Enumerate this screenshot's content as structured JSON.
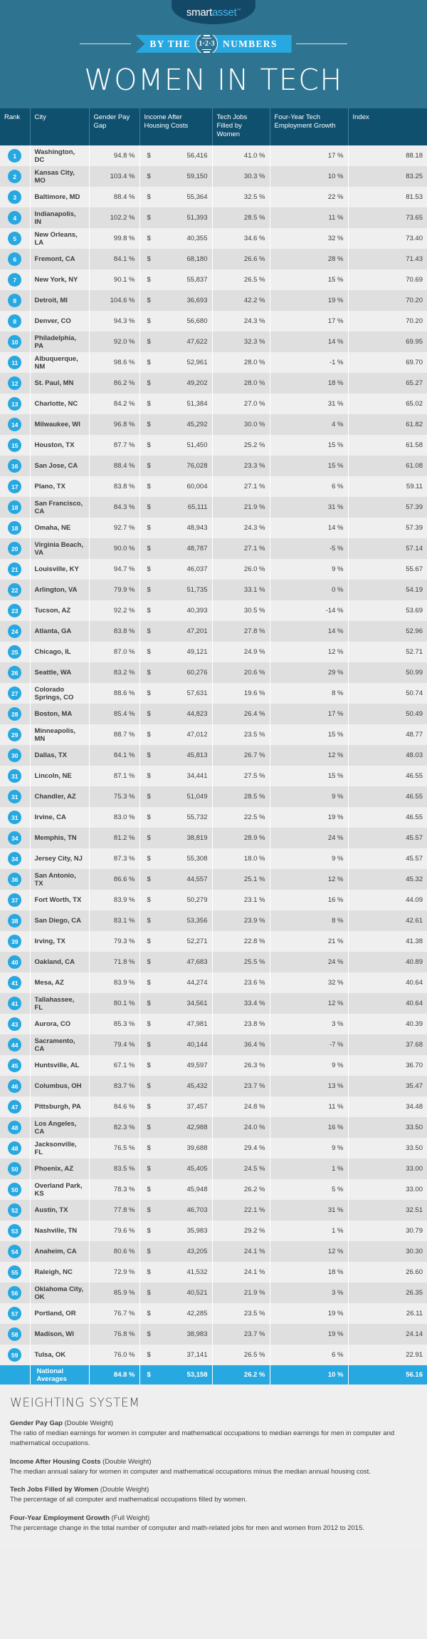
{
  "brand": {
    "logo_smart": "smart",
    "logo_asset": "asset",
    "logo_tm": "™"
  },
  "ribbon": {
    "left_text": "BY THE",
    "badge_digits": "1·2·3",
    "right_text": "NUMBERS"
  },
  "hero": {
    "title": "WOMEN IN TECH"
  },
  "colors": {
    "hero_bg": "#2e7491",
    "header_bg": "#10506f",
    "accent": "#28a8e0",
    "logo_bg": "#134967",
    "row_odd": "#efefef",
    "row_even": "#dfdfdf",
    "footer_bg": "#efefef"
  },
  "table": {
    "columns": [
      "Rank",
      "City",
      "Gender Pay Gap",
      "Income After Housing Costs",
      "Tech Jobs Filled by Women",
      "Four-Year Tech Employment Growth",
      "Index"
    ],
    "rows": [
      {
        "rank": "1",
        "city": "Washington, DC",
        "pay_gap": "94.8 %",
        "income": "56,416",
        "tech_jobs": "41.0 %",
        "growth": "17 %",
        "index": "88.18"
      },
      {
        "rank": "2",
        "city": "Kansas City, MO",
        "pay_gap": "103.4 %",
        "income": "59,150",
        "tech_jobs": "30.3 %",
        "growth": "10 %",
        "index": "83.25"
      },
      {
        "rank": "3",
        "city": "Baltimore, MD",
        "pay_gap": "88.4 %",
        "income": "55,364",
        "tech_jobs": "32.5 %",
        "growth": "22 %",
        "index": "81.53"
      },
      {
        "rank": "4",
        "city": "Indianapolis, IN",
        "pay_gap": "102.2 %",
        "income": "51,393",
        "tech_jobs": "28.5 %",
        "growth": "11 %",
        "index": "73.65"
      },
      {
        "rank": "5",
        "city": "New Orleans, LA",
        "pay_gap": "99.8 %",
        "income": "40,355",
        "tech_jobs": "34.6 %",
        "growth": "32 %",
        "index": "73.40"
      },
      {
        "rank": "6",
        "city": "Fremont, CA",
        "pay_gap": "84.1 %",
        "income": "68,180",
        "tech_jobs": "26.6 %",
        "growth": "28 %",
        "index": "71.43"
      },
      {
        "rank": "7",
        "city": "New York, NY",
        "pay_gap": "90.1 %",
        "income": "55,837",
        "tech_jobs": "26.5 %",
        "growth": "15 %",
        "index": "70.69"
      },
      {
        "rank": "8",
        "city": "Detroit, MI",
        "pay_gap": "104.6 %",
        "income": "36,693",
        "tech_jobs": "42.2 %",
        "growth": "19 %",
        "index": "70.20"
      },
      {
        "rank": "8",
        "city": "Denver, CO",
        "pay_gap": "94.3 %",
        "income": "56,680",
        "tech_jobs": "24.3 %",
        "growth": "17 %",
        "index": "70.20"
      },
      {
        "rank": "10",
        "city": "Philadelphia, PA",
        "pay_gap": "92.0 %",
        "income": "47,622",
        "tech_jobs": "32.3 %",
        "growth": "14 %",
        "index": "69.95"
      },
      {
        "rank": "11",
        "city": "Albuquerque, NM",
        "pay_gap": "98.6 %",
        "income": "52,961",
        "tech_jobs": "28.0 %",
        "growth": "-1 %",
        "index": "69.70"
      },
      {
        "rank": "12",
        "city": "St. Paul, MN",
        "pay_gap": "86.2 %",
        "income": "49,202",
        "tech_jobs": "28.0 %",
        "growth": "18 %",
        "index": "65.27"
      },
      {
        "rank": "13",
        "city": "Charlotte, NC",
        "pay_gap": "84.2 %",
        "income": "51,384",
        "tech_jobs": "27.0 %",
        "growth": "31 %",
        "index": "65.02"
      },
      {
        "rank": "14",
        "city": "Milwaukee, WI",
        "pay_gap": "96.8 %",
        "income": "45,292",
        "tech_jobs": "30.0 %",
        "growth": "4 %",
        "index": "61.82"
      },
      {
        "rank": "15",
        "city": "Houston, TX",
        "pay_gap": "87.7 %",
        "income": "51,450",
        "tech_jobs": "25.2 %",
        "growth": "15 %",
        "index": "61.58"
      },
      {
        "rank": "16",
        "city": "San Jose, CA",
        "pay_gap": "88.4 %",
        "income": "76,028",
        "tech_jobs": "23.3 %",
        "growth": "15 %",
        "index": "61.08"
      },
      {
        "rank": "17",
        "city": "Plano, TX",
        "pay_gap": "83.8 %",
        "income": "60,004",
        "tech_jobs": "27.1 %",
        "growth": "6 %",
        "index": "59.11"
      },
      {
        "rank": "18",
        "city": "San Francisco, CA",
        "pay_gap": "84.3 %",
        "income": "65,111",
        "tech_jobs": "21.9 %",
        "growth": "31 %",
        "index": "57.39"
      },
      {
        "rank": "18",
        "city": "Omaha, NE",
        "pay_gap": "92.7 %",
        "income": "48,943",
        "tech_jobs": "24.3 %",
        "growth": "14 %",
        "index": "57.39"
      },
      {
        "rank": "20",
        "city": "Virginia Beach, VA",
        "pay_gap": "90.0 %",
        "income": "48,787",
        "tech_jobs": "27.1 %",
        "growth": "-5 %",
        "index": "57.14"
      },
      {
        "rank": "21",
        "city": "Louisville, KY",
        "pay_gap": "94.7 %",
        "income": "46,037",
        "tech_jobs": "26.0 %",
        "growth": "9 %",
        "index": "55.67"
      },
      {
        "rank": "22",
        "city": "Arlington, VA",
        "pay_gap": "79.9 %",
        "income": "51,735",
        "tech_jobs": "33.1 %",
        "growth": "0 %",
        "index": "54.19"
      },
      {
        "rank": "23",
        "city": "Tucson, AZ",
        "pay_gap": "92.2 %",
        "income": "40,393",
        "tech_jobs": "30.5 %",
        "growth": "-14 %",
        "index": "53.69"
      },
      {
        "rank": "24",
        "city": "Atlanta, GA",
        "pay_gap": "83.8 %",
        "income": "47,201",
        "tech_jobs": "27.8 %",
        "growth": "14 %",
        "index": "52.96"
      },
      {
        "rank": "25",
        "city": "Chicago, IL",
        "pay_gap": "87.0 %",
        "income": "49,121",
        "tech_jobs": "24.9 %",
        "growth": "12 %",
        "index": "52.71"
      },
      {
        "rank": "26",
        "city": "Seattle, WA",
        "pay_gap": "83.2 %",
        "income": "60,276",
        "tech_jobs": "20.6 %",
        "growth": "29 %",
        "index": "50.99"
      },
      {
        "rank": "27",
        "city": "Colorado Springs, CO",
        "pay_gap": "88.6 %",
        "income": "57,631",
        "tech_jobs": "19.6 %",
        "growth": "8 %",
        "index": "50.74"
      },
      {
        "rank": "28",
        "city": "Boston, MA",
        "pay_gap": "85.4 %",
        "income": "44,823",
        "tech_jobs": "26.4 %",
        "growth": "17 %",
        "index": "50.49"
      },
      {
        "rank": "29",
        "city": "Minneapolis, MN",
        "pay_gap": "88.7 %",
        "income": "47,012",
        "tech_jobs": "23.5 %",
        "growth": "15 %",
        "index": "48.77"
      },
      {
        "rank": "30",
        "city": "Dallas, TX",
        "pay_gap": "84.1 %",
        "income": "45,813",
        "tech_jobs": "26.7 %",
        "growth": "12 %",
        "index": "48.03"
      },
      {
        "rank": "31",
        "city": "Lincoln, NE",
        "pay_gap": "87.1 %",
        "income": "34,441",
        "tech_jobs": "27.5 %",
        "growth": "15 %",
        "index": "46.55"
      },
      {
        "rank": "31",
        "city": "Chandler, AZ",
        "pay_gap": "75.3 %",
        "income": "51,049",
        "tech_jobs": "28.5 %",
        "growth": "9 %",
        "index": "46.55"
      },
      {
        "rank": "31",
        "city": "Irvine, CA",
        "pay_gap": "83.0 %",
        "income": "55,732",
        "tech_jobs": "22.5 %",
        "growth": "19 %",
        "index": "46.55"
      },
      {
        "rank": "34",
        "city": "Memphis, TN",
        "pay_gap": "81.2 %",
        "income": "38,819",
        "tech_jobs": "28.9 %",
        "growth": "24 %",
        "index": "45.57"
      },
      {
        "rank": "34",
        "city": "Jersey City, NJ",
        "pay_gap": "87.3 %",
        "income": "55,308",
        "tech_jobs": "18.0 %",
        "growth": "9 %",
        "index": "45.57"
      },
      {
        "rank": "36",
        "city": "San Antonio, TX",
        "pay_gap": "86.6 %",
        "income": "44,557",
        "tech_jobs": "25.1 %",
        "growth": "12 %",
        "index": "45.32"
      },
      {
        "rank": "37",
        "city": "Fort Worth, TX",
        "pay_gap": "83.9 %",
        "income": "50,279",
        "tech_jobs": "23.1 %",
        "growth": "16 %",
        "index": "44.09"
      },
      {
        "rank": "38",
        "city": "San Diego, CA",
        "pay_gap": "83.1 %",
        "income": "53,356",
        "tech_jobs": "23.9 %",
        "growth": "8 %",
        "index": "42.61"
      },
      {
        "rank": "39",
        "city": "Irving, TX",
        "pay_gap": "79.3 %",
        "income": "52,271",
        "tech_jobs": "22.8 %",
        "growth": "21 %",
        "index": "41.38"
      },
      {
        "rank": "40",
        "city": "Oakland, CA",
        "pay_gap": "71.8 %",
        "income": "47,683",
        "tech_jobs": "25.5 %",
        "growth": "24 %",
        "index": "40.89"
      },
      {
        "rank": "41",
        "city": "Mesa, AZ",
        "pay_gap": "83.9 %",
        "income": "44,274",
        "tech_jobs": "23.6 %",
        "growth": "32 %",
        "index": "40.64"
      },
      {
        "rank": "41",
        "city": "Tallahassee, FL",
        "pay_gap": "80.1 %",
        "income": "34,561",
        "tech_jobs": "33.4 %",
        "growth": "12 %",
        "index": "40.64"
      },
      {
        "rank": "43",
        "city": "Aurora, CO",
        "pay_gap": "85.3 %",
        "income": "47,981",
        "tech_jobs": "23.8 %",
        "growth": "3 %",
        "index": "40.39"
      },
      {
        "rank": "44",
        "city": "Sacramento, CA",
        "pay_gap": "79.4 %",
        "income": "40,144",
        "tech_jobs": "36.4 %",
        "growth": "-7 %",
        "index": "37.68"
      },
      {
        "rank": "45",
        "city": "Huntsville, AL",
        "pay_gap": "67.1 %",
        "income": "49,597",
        "tech_jobs": "26.3 %",
        "growth": "9 %",
        "index": "36.70"
      },
      {
        "rank": "46",
        "city": "Columbus, OH",
        "pay_gap": "83.7 %",
        "income": "45,432",
        "tech_jobs": "23.7 %",
        "growth": "13 %",
        "index": "35.47"
      },
      {
        "rank": "47",
        "city": "Pittsburgh, PA",
        "pay_gap": "84.6 %",
        "income": "37,457",
        "tech_jobs": "24.8 %",
        "growth": "11 %",
        "index": "34.48"
      },
      {
        "rank": "48",
        "city": "Los Angeles, CA",
        "pay_gap": "82.3 %",
        "income": "42,988",
        "tech_jobs": "24.0 %",
        "growth": "16 %",
        "index": "33.50"
      },
      {
        "rank": "48",
        "city": "Jacksonville, FL",
        "pay_gap": "76.5 %",
        "income": "39,688",
        "tech_jobs": "29.4 %",
        "growth": "9 %",
        "index": "33.50"
      },
      {
        "rank": "50",
        "city": "Phoenix, AZ",
        "pay_gap": "83.5 %",
        "income": "45,405",
        "tech_jobs": "24.5 %",
        "growth": "1 %",
        "index": "33.00"
      },
      {
        "rank": "50",
        "city": "Overland Park, KS",
        "pay_gap": "78.3 %",
        "income": "45,948",
        "tech_jobs": "26.2 %",
        "growth": "5 %",
        "index": "33.00"
      },
      {
        "rank": "52",
        "city": "Austin, TX",
        "pay_gap": "77.8 %",
        "income": "46,703",
        "tech_jobs": "22.1 %",
        "growth": "31 %",
        "index": "32.51"
      },
      {
        "rank": "53",
        "city": "Nashville, TN",
        "pay_gap": "79.6 %",
        "income": "35,983",
        "tech_jobs": "29.2 %",
        "growth": "1 %",
        "index": "30.79"
      },
      {
        "rank": "54",
        "city": "Anaheim, CA",
        "pay_gap": "80.6 %",
        "income": "43,205",
        "tech_jobs": "24.1 %",
        "growth": "12 %",
        "index": "30.30"
      },
      {
        "rank": "55",
        "city": "Raleigh, NC",
        "pay_gap": "72.9 %",
        "income": "41,532",
        "tech_jobs": "24.1 %",
        "growth": "18 %",
        "index": "26.60"
      },
      {
        "rank": "56",
        "city": "Oklahoma City, OK",
        "pay_gap": "85.9 %",
        "income": "40,521",
        "tech_jobs": "21.9 %",
        "growth": "3 %",
        "index": "26.35"
      },
      {
        "rank": "57",
        "city": "Portland, OR",
        "pay_gap": "76.7 %",
        "income": "42,285",
        "tech_jobs": "23.5 %",
        "growth": "19 %",
        "index": "26.11"
      },
      {
        "rank": "58",
        "city": "Madison, WI",
        "pay_gap": "76.8 %",
        "income": "38,983",
        "tech_jobs": "23.7 %",
        "growth": "19 %",
        "index": "24.14"
      },
      {
        "rank": "59",
        "city": "Tulsa, OK",
        "pay_gap": "76.0 %",
        "income": "37,141",
        "tech_jobs": "26.5 %",
        "growth": "6 %",
        "index": "22.91"
      }
    ],
    "averages": {
      "label": "National Averages",
      "pay_gap": "84.8 %",
      "income": "53,158",
      "tech_jobs": "26.2 %",
      "growth": "10 %",
      "index": "56.16"
    },
    "currency_symbol": "$"
  },
  "weighting": {
    "title": "WEIGHTING SYSTEM",
    "items": [
      {
        "name": "Gender Pay Gap",
        "weight": "(Double Weight)",
        "description": "The ratio of median earnings for women in computer and mathematical occupations to median earnings for men in computer and mathematical occupations."
      },
      {
        "name": "Income After Housing Costs",
        "weight": "(Double Weight)",
        "description": "The median annual salary for women in computer and mathematical occupations minus the median annual housing cost."
      },
      {
        "name": "Tech Jobs Filled by Women",
        "weight": "(Double Weight)",
        "description": "The percentage of all computer and mathematical occupations filled by women."
      },
      {
        "name": "Four-Year Employment Growth",
        "weight": "(Full Weight)",
        "description": "The percentage change in the total number of computer and math-related jobs for men and women from 2012 to 2015."
      }
    ]
  }
}
